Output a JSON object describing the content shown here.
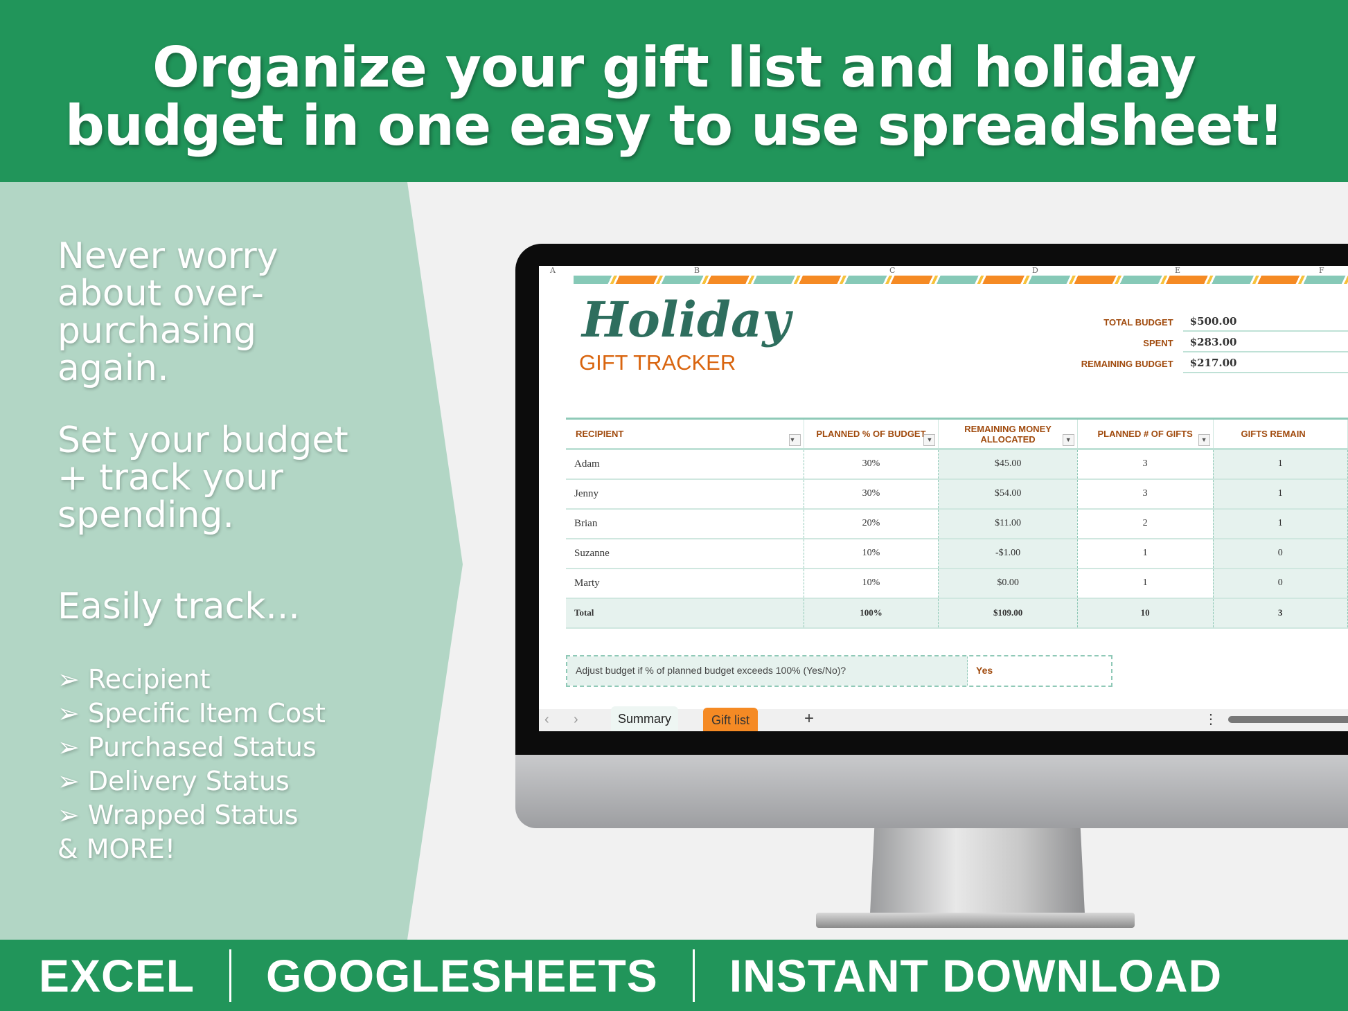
{
  "banner": {
    "line1": "Organize your gift list and holiday",
    "line2": "budget in one easy to use spreadsheet!"
  },
  "left_panel": {
    "p1": [
      "Never worry",
      "about over-",
      "purchasing",
      "again."
    ],
    "p2": [
      "Set your budget",
      "+ track your",
      "spending."
    ],
    "p3": "Easily track...",
    "bullets": [
      "➢ Recipient",
      "➢ Specific Item Cost",
      "➢ Purchased Status",
      "➢ Delivery Status",
      "➢ Wrapped Status"
    ],
    "more": "& MORE!"
  },
  "footer": {
    "items": [
      "EXCEL",
      "GOOGLESHEETS",
      "INSTANT DOWNLOAD"
    ]
  },
  "colors": {
    "green": "#21955a",
    "light_green": "#b2d6c5",
    "teal_title": "#2e6e5e",
    "orange": "#f58a24"
  },
  "sheet": {
    "columns": [
      "A",
      "B",
      "C",
      "D",
      "E",
      "F"
    ],
    "title": "Holiday",
    "subtitle": "GIFT TRACKER",
    "summary": [
      {
        "label": "TOTAL BUDGET",
        "value": "$500.00"
      },
      {
        "label": "SPENT",
        "value": "$283.00"
      },
      {
        "label": "REMAINING BUDGET",
        "value": "$217.00"
      }
    ],
    "headers": [
      "RECIPIENT",
      "PLANNED % OF BUDGET",
      "REMAINING MONEY ALLOCATED",
      "PLANNED # OF GIFTS",
      "GIFTS REMAIN"
    ],
    "rows": [
      [
        "Adam",
        "30%",
        "$45.00",
        "3",
        "1"
      ],
      [
        "Jenny",
        "30%",
        "$54.00",
        "3",
        "1"
      ],
      [
        "Brian",
        "20%",
        "$11.00",
        "2",
        "1"
      ],
      [
        "Suzanne",
        "10%",
        "-$1.00",
        "1",
        "0"
      ],
      [
        "Marty",
        "10%",
        "$0.00",
        "1",
        "0"
      ]
    ],
    "total": [
      "Total",
      "100%",
      "$109.00",
      "10",
      "3"
    ],
    "adjust_label": "Adjust budget if % of planned budget exceeds 100% (Yes/No)?",
    "adjust_value": "Yes",
    "tabs": [
      "Summary",
      "Gift list"
    ],
    "add_tab": "+",
    "nav_prev": "‹",
    "nav_next": "›",
    "more": "⋮"
  }
}
